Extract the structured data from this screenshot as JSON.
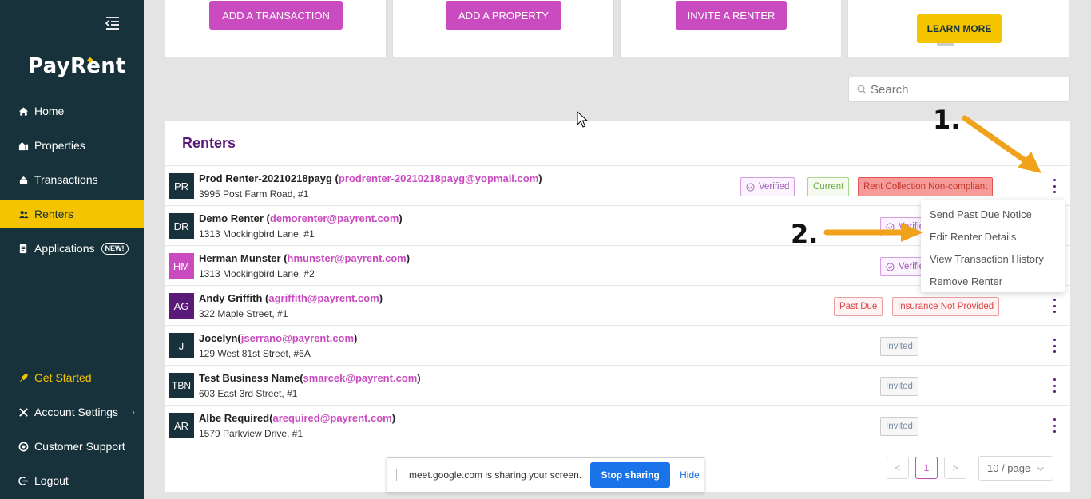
{
  "sidebar": {
    "logo": "PayRent",
    "items": [
      {
        "label": "Home",
        "icon": "home-icon"
      },
      {
        "label": "Properties",
        "icon": "properties-icon"
      },
      {
        "label": "Transactions",
        "icon": "transactions-icon"
      },
      {
        "label": "Renters",
        "icon": "renters-icon",
        "active": true
      },
      {
        "label": "Applications",
        "icon": "applications-icon",
        "badge": "NEW!"
      }
    ],
    "bottom_items": [
      {
        "label": "Get Started",
        "icon": "rocket-icon"
      },
      {
        "label": "Account Settings",
        "icon": "settings-icon"
      },
      {
        "label": "Customer Support",
        "icon": "support-icon"
      },
      {
        "label": "Logout",
        "icon": "logout-icon"
      }
    ]
  },
  "actions": {
    "add_transaction": "ADD A TRANSACTION",
    "add_property": "ADD A PROPERTY",
    "invite_renter": "INVITE A RENTER",
    "learn_more": "LEARN MORE"
  },
  "search": {
    "placeholder": "Search"
  },
  "renters": {
    "title": "Renters",
    "rows": [
      {
        "initials": "PR",
        "name": "Prod Renter-20210218payg",
        "email": "prodrenter-20210218payg@yopmail.com",
        "address": "3995 Post Farm Road, #1",
        "tags": [
          "Verified",
          "Current",
          "Rent Collection Non-compliant"
        ]
      },
      {
        "initials": "DR",
        "name": "Demo Renter",
        "email": "demorenter@payrent.com",
        "address": "1313 Mockingbird Lane, #1",
        "tags": [
          "Verified"
        ]
      },
      {
        "initials": "HM",
        "name": "Herman Munster",
        "email": "hmunster@payrent.com",
        "address": "1313 Mockingbird Lane, #2",
        "tags": [
          "Verified"
        ]
      },
      {
        "initials": "AG",
        "name": "Andy Griffith",
        "email": "agriffith@payrent.com",
        "address": "322 Maple Street, #1",
        "tags": [
          "Past Due",
          "Insurance Not Provided"
        ]
      },
      {
        "initials": "J",
        "name": "Jocelyn",
        "email": "jserrano@payrent.com",
        "address": "129 West 81st Street, #6A",
        "tags": [
          "Invited"
        ]
      },
      {
        "initials": "TBN",
        "name": "Test Business Name",
        "email": "smarcek@payrent.com",
        "address": "603 East 3rd Street, #1",
        "tags": [
          "Invited"
        ]
      },
      {
        "initials": "AR",
        "name": "Albe Required",
        "email": "arequired@payrent.com",
        "address": "1579 Parkview Drive, #1",
        "tags": [
          "Invited"
        ]
      }
    ]
  },
  "menu": {
    "items": [
      "Send Past Due Notice",
      "Edit Renter Details",
      "View Transaction History",
      "Remove Renter"
    ]
  },
  "pagination": {
    "prev": "<",
    "current": "1",
    "next": ">",
    "page_size": "10 / page"
  },
  "share_bar": {
    "text": "meet.google.com is sharing your screen.",
    "stop": "Stop sharing",
    "hide": "Hide"
  },
  "annotations": {
    "step1": "1.",
    "step2": "2."
  },
  "colors": {
    "sidebar": "#17323a",
    "accent_purple": "#c94bbf",
    "accent_yellow": "#f5c400",
    "title_purple": "#5a1a7a",
    "arrow": "#f0a21c"
  }
}
